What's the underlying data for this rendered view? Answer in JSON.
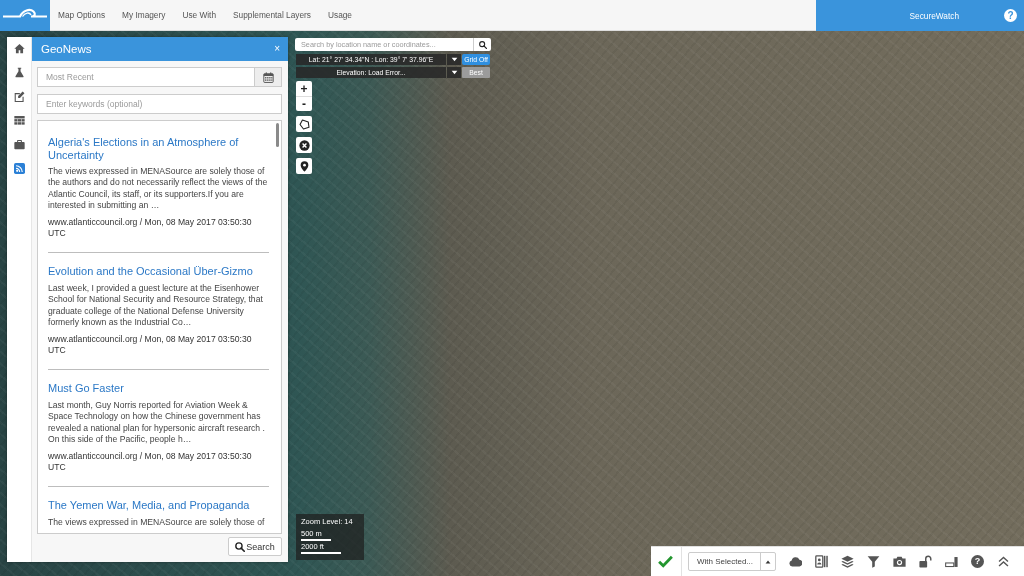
{
  "top_bar": {
    "menu": [
      {
        "label": "Map Options"
      },
      {
        "label": "My Imagery"
      },
      {
        "label": "Use With"
      },
      {
        "label": "Supplemental Layers"
      },
      {
        "label": "Usage"
      }
    ],
    "brand": "SecureWatch",
    "help": "?"
  },
  "sidebar": {
    "items": [
      {
        "kind": "home",
        "selected": false
      },
      {
        "kind": "flask",
        "selected": false
      },
      {
        "kind": "edit",
        "selected": false
      },
      {
        "kind": "table",
        "selected": false
      },
      {
        "kind": "briefcase",
        "selected": false
      },
      {
        "kind": "rss",
        "selected": true
      }
    ]
  },
  "panel": {
    "title": "GeoNews",
    "close": "×",
    "date_field": {
      "placeholder": "Most Recent"
    },
    "keyword_field": {
      "placeholder": "Enter keywords (optional)"
    },
    "articles": [
      {
        "title": "Algeria's Elections in an Atmosphere of Uncertainty",
        "summary": "The views expressed in MENASource are solely those of the authors and do not necessarily reflect the views of the Atlantic Council, its staff, or its supporters.If you are interested in submitting an …",
        "source": "www.atlanticcouncil.org / Mon, 08 May 2017 03:50:30 UTC"
      },
      {
        "title": "Evolution and the Occasional Über-Gizmo",
        "summary": "Last week, I provided a guest lecture at the Eisenhower School for National Security and Resource Strategy, that graduate college of the National Defense University formerly known as the Industrial Co…",
        "source": "www.atlanticcouncil.org / Mon, 08 May 2017 03:50:30 UTC"
      },
      {
        "title": "Must Go Faster",
        "summary": "Last month, Guy Norris reported for Aviation Week & Space Technology on how the Chinese government has revealed a national plan for hypersonic aircraft research . On this side of the Pacific, people h…",
        "source": "www.atlanticcouncil.org / Mon, 08 May 2017 03:50:30 UTC"
      },
      {
        "title": "The Yemen War, Media, and Propaganda",
        "summary": "The views expressed in MENASource are solely those of"
      }
    ],
    "search_button": "Search"
  },
  "map": {
    "search": {
      "placeholder": "Search by location name or coordinates..."
    },
    "coordinates": "Lat: 21° 27' 34.34\"N : Lon: 39° 7' 37.96\"E",
    "grid_button": "Grid Off",
    "elevation": "Elevation: Load Error...",
    "quality": "Best",
    "tools": [
      {
        "kind": "zoom-in",
        "label": "+"
      },
      {
        "kind": "zoom-out",
        "label": "-"
      },
      {
        "kind": "polygon"
      },
      {
        "kind": "clear"
      },
      {
        "kind": "marker"
      }
    ],
    "scale": {
      "zoom": "Zoom Level: 14",
      "metric": "500 m",
      "imperial": "2000 ft"
    }
  },
  "toolbar": {
    "items": [
      {
        "kind": "check"
      },
      {
        "kind": "dropdown",
        "label": "With Selected..."
      },
      {
        "kind": "cloud"
      },
      {
        "kind": "card"
      },
      {
        "kind": "layers"
      },
      {
        "kind": "filter"
      },
      {
        "kind": "camera"
      },
      {
        "kind": "padlock"
      },
      {
        "kind": "slider"
      },
      {
        "kind": "help",
        "label": "?"
      },
      {
        "kind": "chevrons"
      }
    ]
  }
}
